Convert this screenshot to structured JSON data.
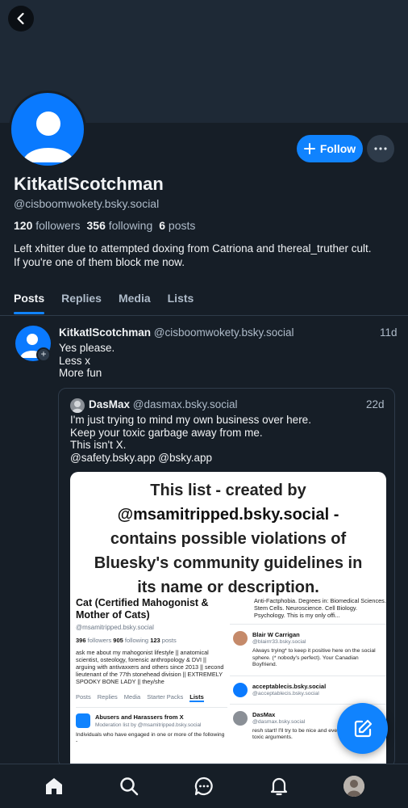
{
  "header": {
    "back_icon": "arrow-left-icon"
  },
  "profile": {
    "display_name": "KitkatlScotchman",
    "handle": "@cisboomwokety.bsky.social",
    "followers_count": "120",
    "followers_label": "followers",
    "following_count": "356",
    "following_label": "following",
    "posts_count": "6",
    "posts_label": "posts",
    "bio_line1": "Left xhitter due to attempted doxing from Catriona and thereal_truther cult.",
    "bio_line2": "If you're one of them block me now.",
    "follow_label": "Follow"
  },
  "tabs": [
    {
      "label": "Posts",
      "active": true
    },
    {
      "label": "Replies"
    },
    {
      "label": "Media"
    },
    {
      "label": "Lists"
    }
  ],
  "post": {
    "author": "KitkatlScotchman",
    "handle": "@cisboomwokety.bsky.social",
    "time": "11d",
    "lines": [
      "Yes please.",
      "Less x",
      "More fun"
    ]
  },
  "quote": {
    "author": "DasMax",
    "handle": "@dasmax.bsky.social",
    "time": "22d",
    "lines": [
      "I'm just trying to mind my own business over here.",
      "Keep your toxic garbage away from me.",
      "This isn't X.",
      "@safety.bsky.app @bsky.app"
    ]
  },
  "embed": {
    "title_lines": [
      "This list - created by",
      "@msamitripped.bsky.social -",
      "contains possible violations of",
      "Bluesky's community guidelines in",
      "its name or description."
    ],
    "left": {
      "name": "Cat (Certified Mahogonist & Mother of Cats)",
      "handle": "@msamitripped.bsky.social",
      "followers": "396",
      "followers_label": "followers",
      "following": "905",
      "following_label": "following",
      "posts": "123",
      "posts_label": "posts",
      "bio": "ask me about my mahogonist lifestyle || anatomical scientist, osteology, forensic anthropology & DVI || arguing with antivaxxers and others since 2013 || second lieutenant of the 77th stonehead division || EXTREMELY SPOOKY BONE LADY || they/she",
      "tabs": [
        "Posts",
        "Replies",
        "Media",
        "Starter Packs",
        "Lists"
      ],
      "list_title": "Abusers and Harassers from X",
      "list_sub": "Moderation list by @msamitripped.bsky.social",
      "list_desc": "Individuals who have engaged in one or more of the following -"
    },
    "right": {
      "top_text": "Anti-Factphobia. Degrees in: Biomedical Sciences. Stem Cells. Neuroscience. Cell Biology. Psychology. This is my only offi...",
      "items": [
        {
          "name": "Blair W Carrigan",
          "handle": "@blairrr33.bsky.social",
          "text": "Always trying* to keep it positive here on the social sphere. (* nobody's perfect). Your Canadian Boyfriend."
        },
        {
          "name": "acceptablecis.bsky.social",
          "handle": "@acceptablecis.bsky.social",
          "text": ""
        },
        {
          "name": "DasMax",
          "handle": "@dasmax.bsky.social",
          "text": "resh start! I'll try to be nice and everyone's feeds with toxic arguments."
        }
      ]
    }
  },
  "nav": [
    "home-icon",
    "search-icon",
    "chat-icon",
    "bell-icon",
    "profile-avatar"
  ],
  "colors": {
    "accent": "#1083fe",
    "background": "#161e27",
    "banner": "#1e2936"
  }
}
